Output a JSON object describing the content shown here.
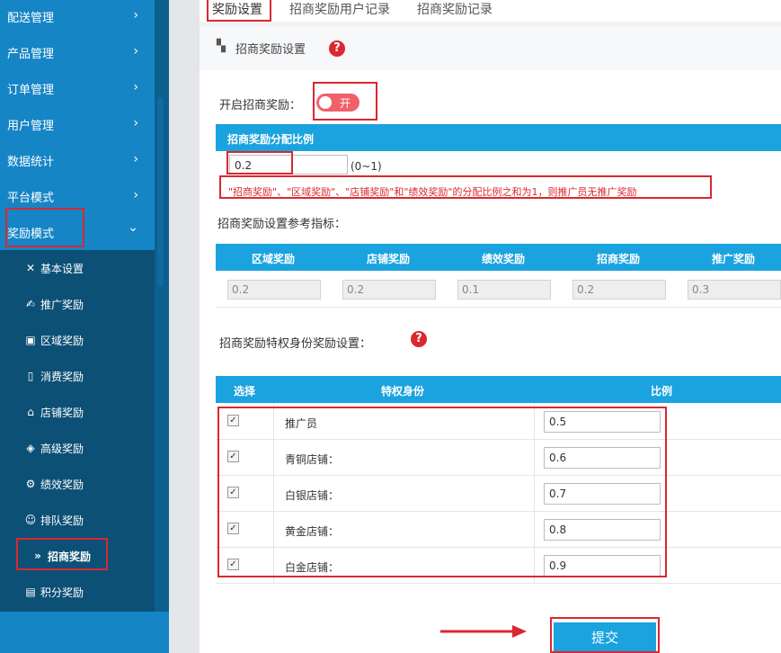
{
  "sidebar": {
    "items": [
      {
        "label": "配送管理",
        "chevron": "›"
      },
      {
        "label": "产品管理",
        "chevron": "›"
      },
      {
        "label": "订单管理",
        "chevron": "›"
      },
      {
        "label": "用户管理",
        "chevron": "›"
      },
      {
        "label": "数据统计",
        "chevron": "›"
      },
      {
        "label": "平台模式",
        "chevron": "›"
      },
      {
        "label": "奖励模式",
        "chevron": "⌄"
      }
    ],
    "sub_items": [
      {
        "label": "基本设置",
        "icon": "✕"
      },
      {
        "label": "推广奖励",
        "icon": "✍"
      },
      {
        "label": "区域奖励",
        "icon": "▣"
      },
      {
        "label": "消费奖励",
        "icon": "▯"
      },
      {
        "label": "店铺奖励",
        "icon": "⌂"
      },
      {
        "label": "高级奖励",
        "icon": "◈"
      },
      {
        "label": "绩效奖励",
        "icon": "⚙"
      },
      {
        "label": "排队奖励",
        "icon": "☺"
      },
      {
        "label": "招商奖励",
        "icon": "»"
      },
      {
        "label": "积分奖励",
        "icon": "▤"
      }
    ]
  },
  "tabs": [
    {
      "label": "奖励设置"
    },
    {
      "label": "招商奖励用户记录"
    },
    {
      "label": "招商奖励记录"
    }
  ],
  "panel": {
    "title": "招商奖励设置",
    "help": "?",
    "toggle_label": "开启招商奖励：",
    "toggle_text": "开",
    "ratio_bar": "招商奖励分配比例",
    "ratio_value": "0.2",
    "ratio_range": "(0~1)",
    "ratio_note": "\"招商奖励\"、\"区域奖励\"、\"店铺奖励\"和\"绩效奖励\"的分配比例之和为1，则推广员无推广奖励",
    "ref_label": "招商奖励设置参考指标：",
    "ref_headers": [
      "区域奖励",
      "店铺奖励",
      "绩效奖励",
      "招商奖励",
      "推广奖励"
    ],
    "ref_values": [
      "0.2",
      "0.2",
      "0.1",
      "0.2",
      "0.3"
    ],
    "priv_label": "招商奖励特权身份奖励设置：",
    "priv_headers": {
      "select": "选择",
      "identity": "特权身份",
      "ratio": "比例"
    },
    "priv_rows": [
      {
        "name": "推广员",
        "ratio": "0.5",
        "checked": true
      },
      {
        "name": "青铜店铺：",
        "ratio": "0.6",
        "checked": true
      },
      {
        "name": "白银店铺：",
        "ratio": "0.7",
        "checked": true
      },
      {
        "name": "黄金店铺：",
        "ratio": "0.8",
        "checked": true
      },
      {
        "name": "白金店铺：",
        "ratio": "0.9",
        "checked": true
      }
    ],
    "submit": "提交"
  },
  "colors": {
    "sidebar": "#1685c6",
    "accent": "#1aa3df",
    "highlight": "#d9282f",
    "toggle": "#f0616a"
  }
}
